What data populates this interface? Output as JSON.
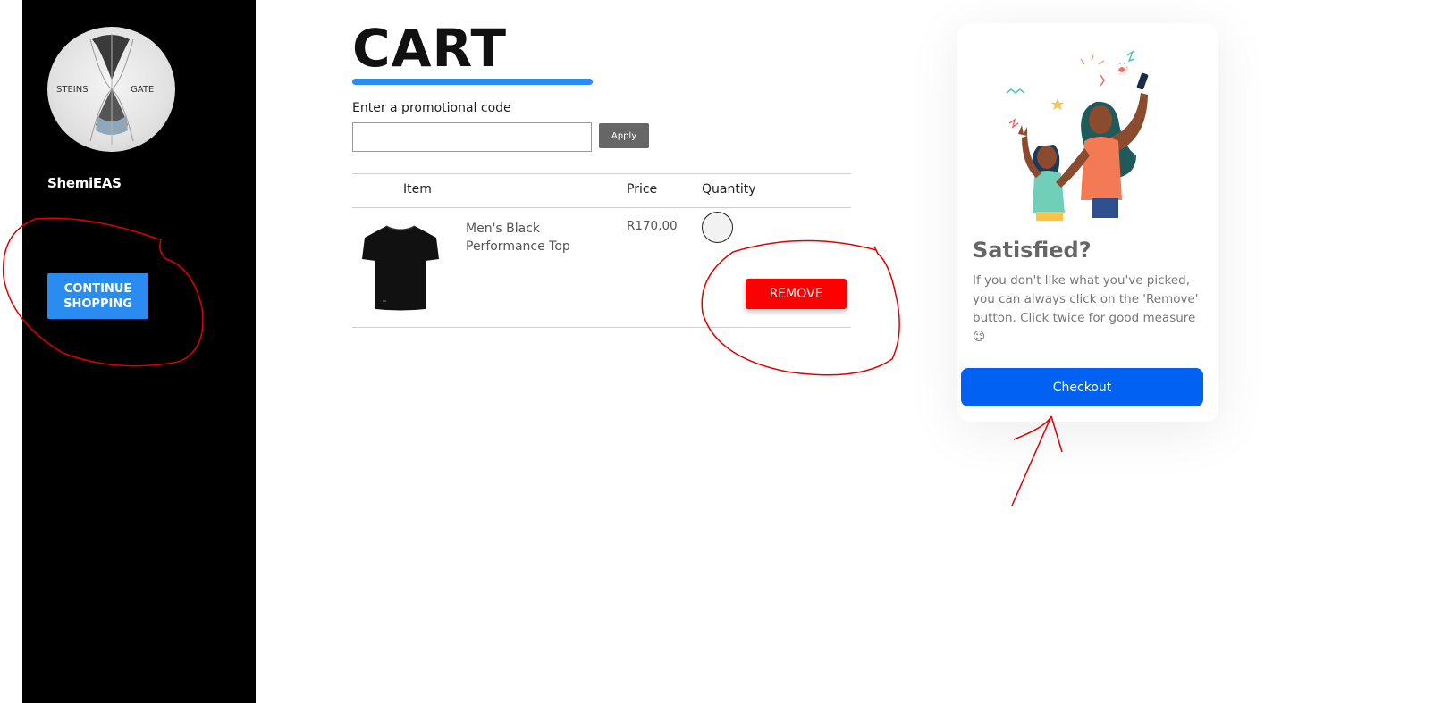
{
  "sidebar": {
    "username": "ShemiEAS",
    "avatar_text_left": "STEINS",
    "avatar_text_right": "GATE",
    "continue_label": "CONTINUE SHOPPING"
  },
  "cart": {
    "title": "CART",
    "promo_label": "Enter a promotional code",
    "promo_value": "",
    "apply_label": "Apply",
    "columns": [
      "Item",
      "Price",
      "Quantity"
    ],
    "items": [
      {
        "name": "Men's Black Performance Top",
        "price": "R170,00",
        "quantity": "",
        "remove_label": "REMOVE"
      }
    ]
  },
  "card": {
    "title": "Satisfied?",
    "text": "If you don't like what you've picked, you can always click on the 'Remove' button. Click twice for good measure 😉",
    "checkout_label": "Checkout"
  },
  "colors": {
    "accent": "#2a8cf0",
    "checkout": "#0061f2",
    "remove": "#ff0000",
    "annotation": "#e00000"
  }
}
